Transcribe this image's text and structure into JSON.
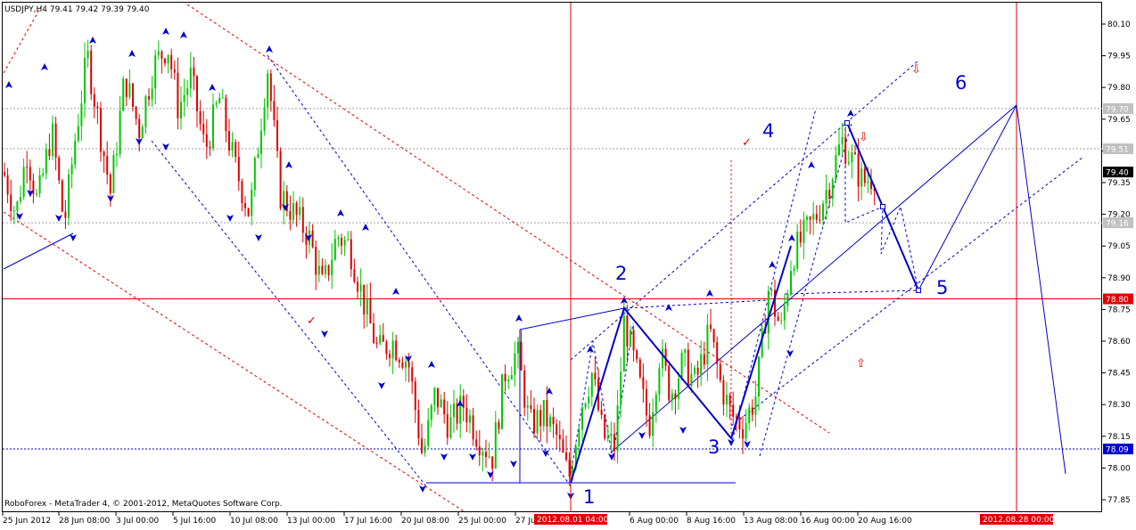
{
  "header": {
    "symbol": "USDJPY,H4",
    "ohlc": "79.41 79.42 79.39 79.40"
  },
  "footer": {
    "copyright": "RoboForex - MetaTrader 4, © 2001-2012, MetaQuotes Software Corp."
  },
  "colors": {
    "background": "#ffffff",
    "bull": "#00c800",
    "bear": "#e00000",
    "projection": "#0000cc",
    "channel_red": "#e00000",
    "grid_gray": "#a0a0a0",
    "tag_gray": "#c0c0c0",
    "tag_red": "#e00000",
    "tag_black": "#000000"
  },
  "chart_data": {
    "type": "candlestick",
    "title": "USDJPY,H4",
    "y_range": [
      77.8,
      80.15
    ],
    "y_ticks": [
      "80.10",
      "79.95",
      "79.80",
      "79.65",
      "79.50",
      "79.35",
      "79.20",
      "79.05",
      "78.90",
      "78.75",
      "78.60",
      "78.45",
      "78.30",
      "78.15",
      "78.00",
      "77.85"
    ],
    "x_tick_labels": [
      "25 Jun 2012",
      "28 Jun 08:00",
      "3 Jul 00:00",
      "5 Jul 16:00",
      "10 Jul 08:00",
      "13 Jul 00:00",
      "17 Jul 16:00",
      "20 Jul 08:00",
      "25 Jul 00:00",
      "27 Jul 16:00",
      "6 Aug 00:00",
      "8 Aug 16:00",
      "13 Aug 08:00",
      "16 Aug 00:00",
      "20 Aug 16:00"
    ],
    "time_marker_labels": [
      "2012.08.01 04:00",
      "2012.08.28 00:00"
    ],
    "price_tags": [
      {
        "text": "79.70",
        "value": 79.7,
        "style": "gray"
      },
      {
        "text": "79.51",
        "value": 79.51,
        "style": "gray"
      },
      {
        "text": "79.40",
        "value": 79.4,
        "style": "black"
      },
      {
        "text": "79.16",
        "value": 79.16,
        "style": "gray"
      },
      {
        "text": "78.80",
        "value": 78.8,
        "style": "red"
      },
      {
        "text": "78.09",
        "value": 78.09,
        "style": "blue"
      }
    ],
    "horizontal_levels": [
      {
        "value": 79.7,
        "style": "gray-dotted"
      },
      {
        "value": 79.51,
        "style": "gray-dotted"
      },
      {
        "value": 79.16,
        "style": "gray-dotted"
      },
      {
        "value": 78.8,
        "style": "red-solid"
      },
      {
        "value": 78.09,
        "style": "blue-dotted"
      }
    ],
    "wave_labels": [
      {
        "label": "1",
        "time": "2012.08.01 04:00",
        "price": 77.85
      },
      {
        "label": "2",
        "time": "6 Aug 00:00",
        "price": 78.89
      },
      {
        "label": "3",
        "time": "8 Aug 16:00",
        "price": 78.12
      },
      {
        "label": "4",
        "time": "13 Aug 08:00",
        "price": 79.58
      },
      {
        "label": "5",
        "time": "22 Aug",
        "price": 78.84
      },
      {
        "label": "6",
        "time": "27 Aug",
        "price": 79.84
      }
    ],
    "wave_path": [
      {
        "time": "2012.08.01 04:00",
        "price": 77.88
      },
      {
        "time": "6 Aug 00:00",
        "price": 78.77
      },
      {
        "time": "8 Aug 16:00",
        "price": 78.15
      },
      {
        "time": "13 Aug 08:00",
        "price": 78.62
      }
    ],
    "projection_path": [
      {
        "time": "17 Aug",
        "price": 79.63
      },
      {
        "time": "20 Aug 16:00",
        "price": 79.22
      },
      {
        "time": "22 Aug",
        "price": 78.84
      },
      {
        "time": "2012.08.28 00:00",
        "price": 79.7
      },
      {
        "time": "29 Aug",
        "price": 77.97
      }
    ],
    "last_price": 79.4
  }
}
